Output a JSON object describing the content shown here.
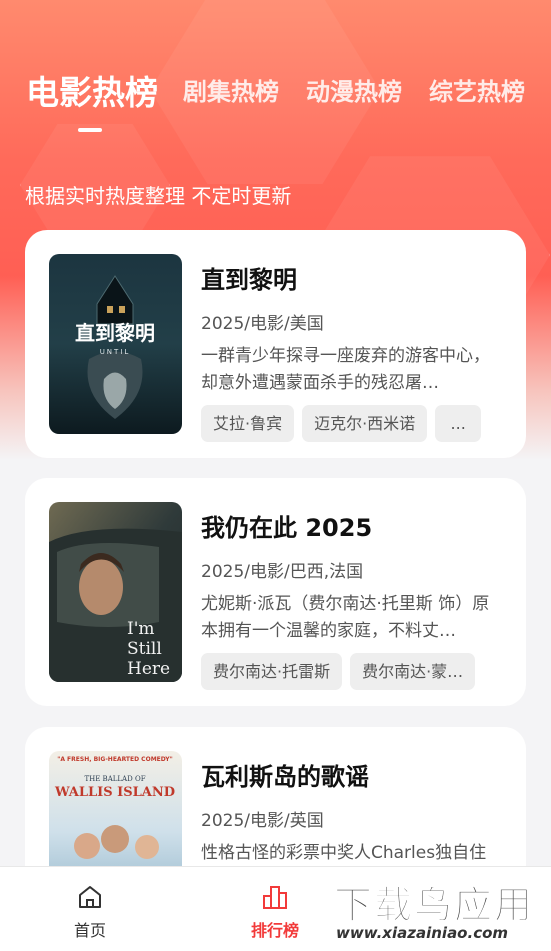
{
  "tabs": [
    {
      "label": "电影热榜",
      "active": true
    },
    {
      "label": "剧集热榜",
      "active": false
    },
    {
      "label": "动漫热榜",
      "active": false
    },
    {
      "label": "综艺热榜",
      "active": false
    }
  ],
  "subtitle": "根据实时热度整理 不定时更新",
  "movies": [
    {
      "title": "直到黎明",
      "meta": "2025/电影/美国",
      "desc": "一群青少年探寻一座废弃的游客中心，却意外遭遇蒙面杀手的残忍屠…",
      "cast": [
        "艾拉·鲁宾",
        "迈克尔·西米诺",
        "..."
      ],
      "poster_text": [
        "直到黎明",
        "UNTIL"
      ]
    },
    {
      "title": "我仍在此 2025",
      "meta": "2025/电影/巴西,法国",
      "desc": "尤妮斯·派瓦（费尔南达·托里斯 饰）原本拥有一个温馨的家庭，不料丈…",
      "cast": [
        "费尔南达·托雷斯",
        "费尔南达·蒙…"
      ],
      "poster_text": [
        "I'm",
        "Still",
        "Here"
      ]
    },
    {
      "title": "瓦利斯岛的歌谣",
      "meta": "2025/电影/英国",
      "desc": "性格古怪的彩票中奖人Charles独自住在一个偏远的小岛上，他梦想着自…",
      "cast": [],
      "poster_text": [
        "\"A FRESH, BIG-HEARTED COMEDY\"",
        "THE BALLAD OF",
        "WALLIS ISLAND"
      ]
    }
  ],
  "bottom_nav": [
    {
      "label": "首页",
      "icon": "home-icon",
      "active": false
    },
    {
      "label": "排行榜",
      "icon": "ranking-icon",
      "active": true
    }
  ],
  "watermark": {
    "main": "下载鸟应用",
    "url": "www.xiazainiao.com"
  },
  "colors": {
    "accent": "#f23a3a",
    "hero_top": "#ff8a6e",
    "hero_mid": "#ff5f54"
  }
}
